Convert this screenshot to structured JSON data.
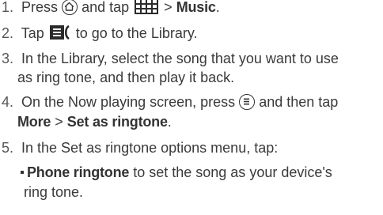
{
  "steps": {
    "s1": {
      "num": "1.",
      "pre": "Press",
      "mid": "and tap",
      "arrow": ">",
      "bold": "Music",
      "post": "."
    },
    "s2": {
      "num": "2.",
      "pre": "Tap",
      "post": "to go to the Library."
    },
    "s3": {
      "num": "3.",
      "line1": "In the Library, select the song that you want to use",
      "line2": "as ring tone, and then play it back."
    },
    "s4": {
      "num": "4.",
      "pre": "On the Now playing screen, press",
      "post": "and then tap",
      "bold1": "More",
      "arrow": ">",
      "bold2": "Set as ringtone",
      "end": "."
    },
    "s5": {
      "num": "5.",
      "text": "In the Set as ringtone options menu, tap:"
    }
  },
  "sub": {
    "bold": "Phone ringtone",
    "rest": "to set the song as your device's",
    "line2": "ring tone."
  },
  "icons": {
    "home": "home-icon",
    "all_apps": "all-apps-grid-icon",
    "library": "library-icon",
    "menu": "menu-icon"
  }
}
